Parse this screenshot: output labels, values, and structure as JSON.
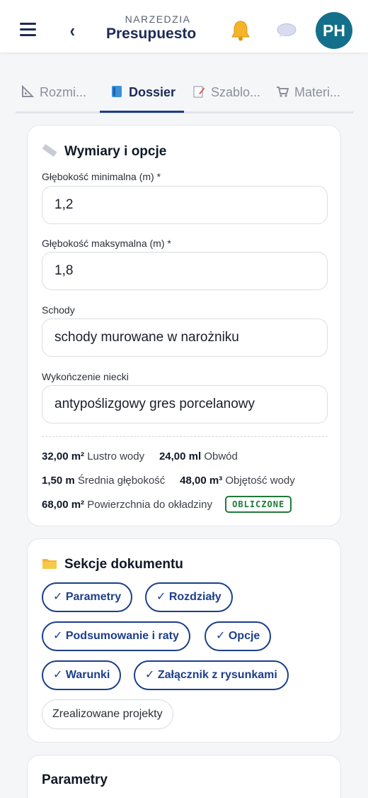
{
  "header": {
    "breadcrumb": "NARZEDZIA",
    "title": "Presupuesto",
    "back_icon": "‹",
    "avatar_initials": "PH"
  },
  "tabs": [
    {
      "label": "Rozmi...",
      "icon": "ruler-icon"
    },
    {
      "label": "Dossier",
      "icon": "book-icon"
    },
    {
      "label": "Szablo...",
      "icon": "memo-icon"
    },
    {
      "label": "Materi...",
      "icon": "cart-icon"
    }
  ],
  "dimensions": {
    "title": "Wymiary i opcje",
    "fields": [
      {
        "label": "Głębokość minimalna (m) *",
        "value": "1,2"
      },
      {
        "label": "Głębokość maksymalna (m) *",
        "value": "1,8"
      },
      {
        "label": "Schody",
        "value": "schody murowane w narożniku"
      },
      {
        "label": "Wykończenie niecki",
        "value": "antypoślizgowy gres porcelanowy"
      }
    ],
    "stats": {
      "lustro_value": "32,00 m²",
      "lustro_label": "Lustro wody",
      "obwod_value": "24,00 ml",
      "obwod_label": "Obwód",
      "srednia_value": "1,50 m",
      "srednia_label": "Średnia głębokość",
      "objetosc_value": "48,00 m³",
      "objetosc_label": "Objętość wody",
      "powierzchnia_value": "68,00 m²",
      "powierzchnia_label": "Powierzchnia do okładziny",
      "badge": "OBLICZONE"
    }
  },
  "sections": {
    "title": "Sekcje dokumentu",
    "chips": [
      {
        "label": "✓ Parametry",
        "selected": true
      },
      {
        "label": "✓ Rozdziały",
        "selected": true
      },
      {
        "label": "✓ Podsumowanie i raty",
        "selected": true
      },
      {
        "label": "✓ Opcje",
        "selected": true
      },
      {
        "label": "✓ Warunki",
        "selected": true
      },
      {
        "label": "✓ Załącznik z rysunkami",
        "selected": true
      },
      {
        "label": "Zrealizowane projekty",
        "selected": false
      }
    ]
  },
  "parametry": {
    "title": "Parametry"
  },
  "colors": {
    "navy": "#1c2a55",
    "accent": "#1c3f8a",
    "avatar": "#14708a",
    "badge_green": "#1f7a3a"
  }
}
